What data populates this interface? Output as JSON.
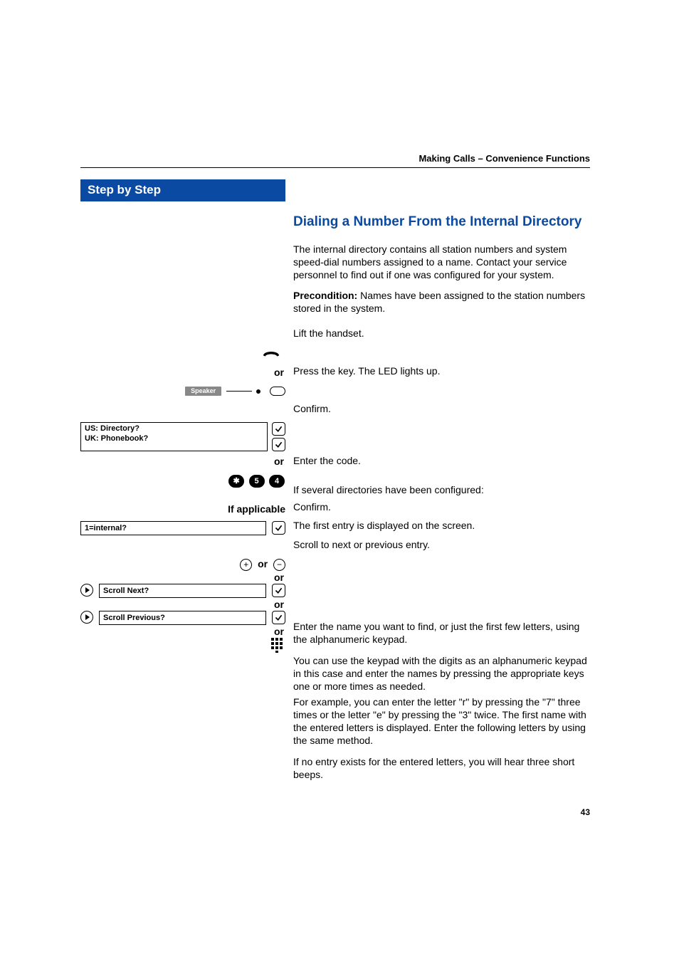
{
  "running_head": "Making Calls – Convenience Functions",
  "sidebar_title": "Step by Step",
  "section_title": "Dialing a Number From the Internal Directory",
  "intro": "The internal directory contains all station numbers and system speed-dial numbers assigned to a name. Contact your service personnel to find out if one was configured for your system.",
  "precond_label": "Precondition:",
  "precond_text": " Names have been assigned to the station numbers stored in the system.",
  "lift": "Lift the handset.",
  "or": "or",
  "speaker_label": "Speaker",
  "press_key": "Press the key. The LED lights up.",
  "menu_directory_us": "US: Directory?",
  "menu_directory_uk": "UK: Phonebook?",
  "confirm": "Confirm.",
  "code_keys": [
    "✱",
    "5",
    "4"
  ],
  "enter_code": "Enter the code.",
  "if_applicable": "If applicable",
  "several_dirs": "If several directories have been configured:",
  "menu_internal": "1=internal?",
  "first_entry": "The first entry is displayed on the screen.",
  "plusminus_or": "or",
  "scroll_line": "Scroll to next or previous entry.",
  "scroll_next": "Scroll Next?",
  "scroll_prev": "Scroll Previous?",
  "enter_name": "Enter the name you want to find, or just the first few letters, using the alphanumeric keypad.",
  "alpha1": "You can use the keypad with the digits as an alphanumeric keypad in this case and enter the names by pressing the appropriate keys one or more times as needed.",
  "alpha2": "For example, you can enter the letter \"r\" by pressing the \"7\" three times or the letter \"e\" by pressing the \"3\" twice. The first name with the entered letters is displayed. Enter the following letters by using the same method.",
  "no_entry": "If no entry exists for the entered letters, you will hear three short beeps.",
  "page_number": "43"
}
